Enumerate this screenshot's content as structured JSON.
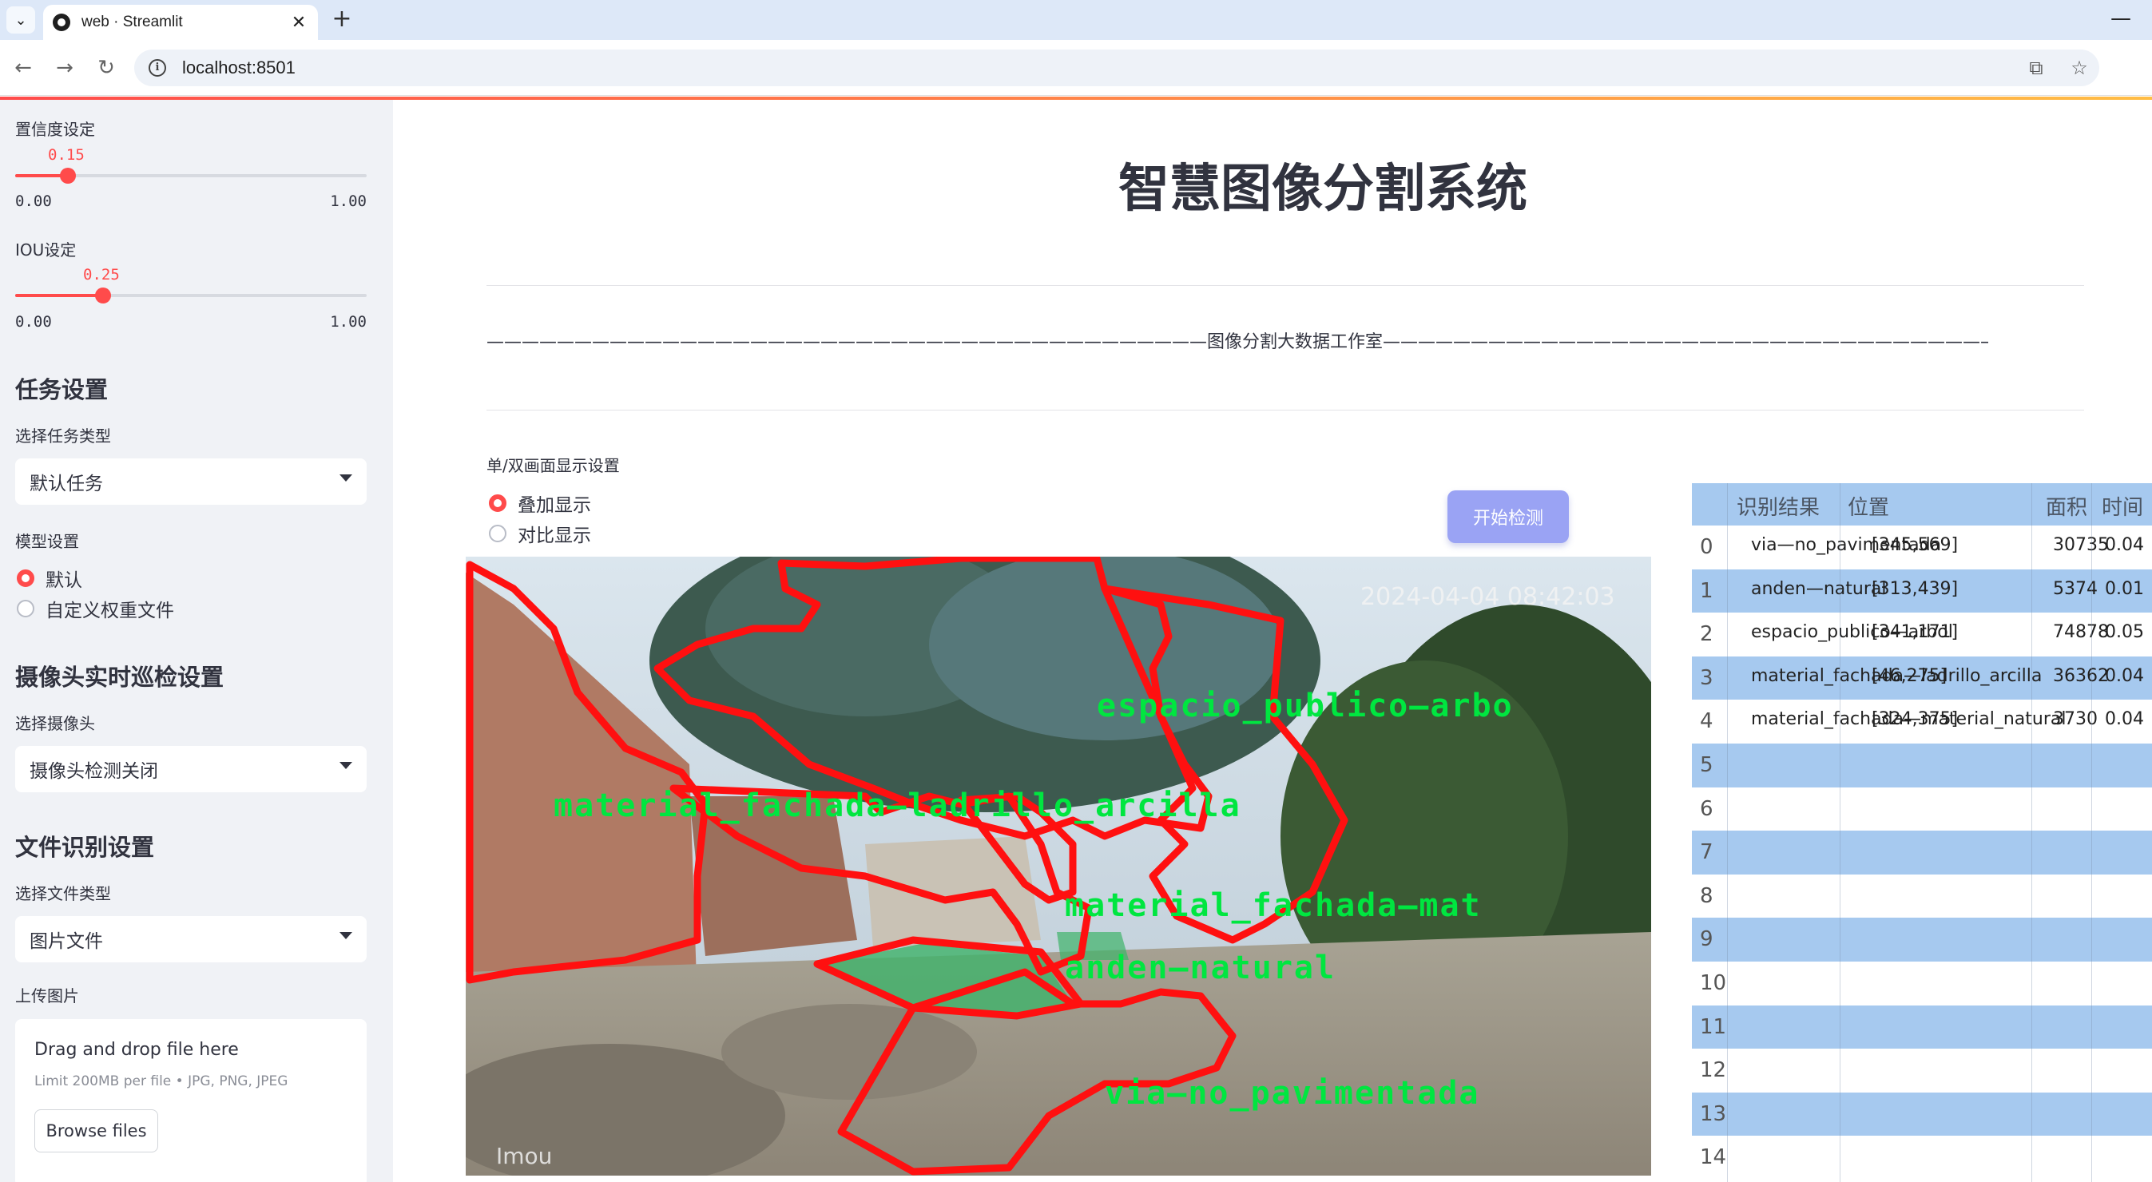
{
  "browser": {
    "tab_title": "web · Streamlit",
    "url": "localhost:8501"
  },
  "sidebar": {
    "confidence": {
      "label": "置信度设定",
      "value": "0.15",
      "value_fraction": 0.15,
      "min": "0.00",
      "max": "1.00"
    },
    "iou": {
      "label": "IOU设定",
      "value": "0.25",
      "value_fraction": 0.25,
      "min": "0.00",
      "max": "1.00"
    },
    "task_heading": "任务设置",
    "task_type_label": "选择任务类型",
    "task_type_value": "默认任务",
    "model_label": "模型设置",
    "model_options": [
      "默认",
      "自定义权重文件"
    ],
    "model_selected": 0,
    "camera_heading": "摄像头实时巡检设置",
    "camera_label": "选择摄像头",
    "camera_value": "摄像头检测关闭",
    "file_heading": "文件识别设置",
    "file_type_label": "选择文件类型",
    "file_type_value": "图片文件",
    "upload_label": "上传图片",
    "upload_main": "Drag and drop file here",
    "upload_sub": "Limit 200MB per file • JPG, PNG, JPEG",
    "browse_label": "Browse files"
  },
  "main": {
    "title": "智慧图像分割系统",
    "studio_line": "—————————————————————————————————————————图像分割大数据工作室—————————————————————————————————————————",
    "display_label": "单/双画面显示设置",
    "display_options": [
      "叠加显示",
      "对比显示"
    ],
    "display_selected": 0,
    "start_button": "开始检测",
    "image": {
      "timestamp": "2024-04-04 08:42:03",
      "watermark": "Imou",
      "labels": [
        "espacio_publico—arbo",
        "material_fachada—ladrillo_arcilla",
        "material_fachada—mat",
        "anden—natural",
        "via—no_pavimentada"
      ]
    }
  },
  "table": {
    "headers": [
      "识别结果",
      "位置",
      "面积",
      "时间"
    ],
    "rows": [
      {
        "index": "0",
        "result": "via—no_pavimentada",
        "position": "[345,569]",
        "area": "30735",
        "time": "0.04"
      },
      {
        "index": "1",
        "result": "anden—natural",
        "position": "[313,439]",
        "area": "5374",
        "time": "0.01"
      },
      {
        "index": "2",
        "result": "espacio_publico—arbol",
        "position": "[341,171]",
        "area": "74878",
        "time": "0.05"
      },
      {
        "index": "3",
        "result": "material_fachada—ladrillo_arcilla",
        "position": "[46,275]",
        "area": "36362",
        "time": "0.04"
      },
      {
        "index": "4",
        "result": "material_fachada—material_natural",
        "position": "[324,375]",
        "area": "3730",
        "time": "0.04"
      },
      {
        "index": "5"
      },
      {
        "index": "6"
      },
      {
        "index": "7"
      },
      {
        "index": "8"
      },
      {
        "index": "9"
      },
      {
        "index": "10"
      },
      {
        "index": "11"
      },
      {
        "index": "12"
      },
      {
        "index": "13"
      },
      {
        "index": "14"
      }
    ]
  }
}
